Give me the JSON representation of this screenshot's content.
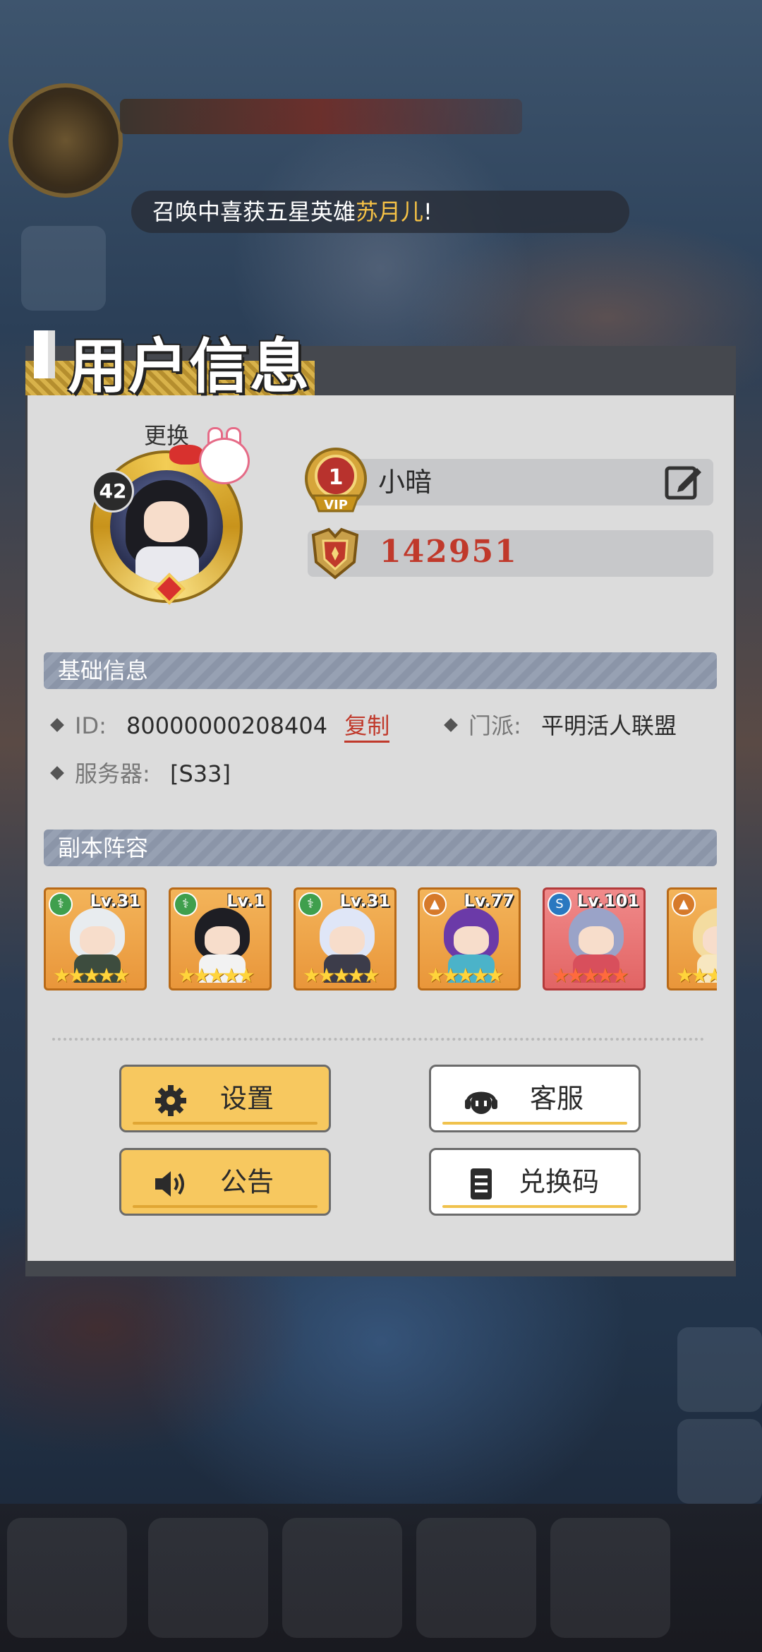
{
  "notice": {
    "prefix": "召唤中喜获五星英雄",
    "hero": "苏月儿",
    "suffix": "!"
  },
  "panel": {
    "title": "用户信息"
  },
  "profile": {
    "change_label": "更换",
    "level": "42",
    "vip_level": "1",
    "vip_label": "VIP",
    "name": "小暗",
    "power": "142951"
  },
  "basic_info": {
    "header": "基础信息",
    "id_label": "ID:",
    "id_value": "80000000208404",
    "copy_label": "复制",
    "faction_label": "门派:",
    "faction_value": "平明活人联盟",
    "server_label": "服务器:",
    "server_value": "[S33]"
  },
  "lineup": {
    "header": "副本阵容",
    "heroes": [
      {
        "level": "Lv.31",
        "type": "green",
        "stars": "★★★★★",
        "frame": "orange",
        "hair": "#e8ecef",
        "outfit": "#3d4c3e"
      },
      {
        "level": "Lv.1",
        "type": "green",
        "stars": "★★★★★",
        "frame": "orange",
        "hair": "#1e1e24",
        "outfit": "#f2f2f2"
      },
      {
        "level": "Lv.31",
        "type": "green",
        "stars": "★★★★★",
        "frame": "orange",
        "hair": "#dfe6f7",
        "outfit": "#3c3c4a"
      },
      {
        "level": "Lv.77",
        "type": "orange",
        "stars": "★★★★★",
        "frame": "orange",
        "hair": "#6b3aa8",
        "outfit": "#4bb3c9"
      },
      {
        "level": "Lv.101",
        "type": "blue",
        "stars": "★★★★★",
        "frame": "red",
        "hair": "#9aa3c8",
        "outfit": "#d84f5c"
      },
      {
        "level": "",
        "type": "orange",
        "stars": "★★★★★",
        "frame": "orange",
        "hair": "#f4dca0",
        "outfit": "#f7e7c0"
      }
    ]
  },
  "buttons": {
    "settings": "设置",
    "support": "客服",
    "announcement": "公告",
    "redeem": "兑换码"
  },
  "icons": {
    "edit": "edit-icon",
    "vip": "vip-badge-icon",
    "power": "combat-power-icon",
    "settings": "gear-icon",
    "support": "headset-icon",
    "announcement": "speaker-icon",
    "redeem": "document-icon"
  },
  "colors": {
    "accent_yellow": "#f7c85f",
    "highlight": "#f6c246",
    "power_red": "#c0392b",
    "panel_bg": "#dcdcdc",
    "section_header": "#8b95a8"
  }
}
